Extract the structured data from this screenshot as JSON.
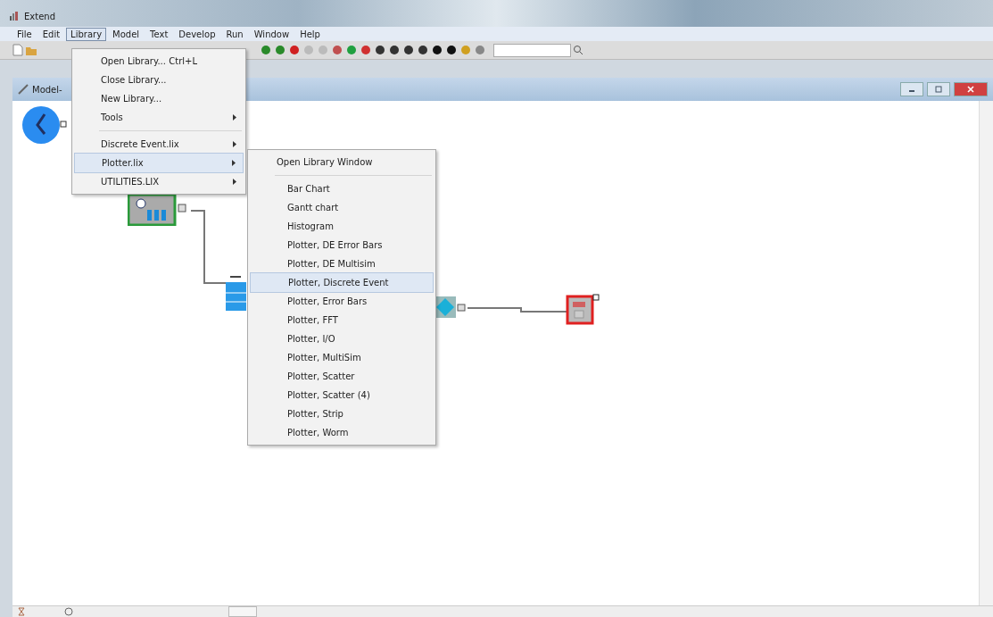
{
  "window": {
    "title": "Extend"
  },
  "menu_bar": [
    {
      "label": "File",
      "selected": false
    },
    {
      "label": "Edit",
      "selected": false
    },
    {
      "label": "Library",
      "selected": true
    },
    {
      "label": "Model",
      "selected": false
    },
    {
      "label": "Text",
      "selected": false
    },
    {
      "label": "Develop",
      "selected": false
    },
    {
      "label": "Run",
      "selected": false
    },
    {
      "label": "Window",
      "selected": false
    },
    {
      "label": "Help",
      "selected": false
    }
  ],
  "library_menu": [
    {
      "kind": "item",
      "label": "Open Library...",
      "shortcut": "Ctrl+L",
      "submenu": false,
      "selected": false
    },
    {
      "kind": "item",
      "label": "Close Library...",
      "submenu": false,
      "selected": false
    },
    {
      "kind": "item",
      "label": "New Library...",
      "submenu": false,
      "selected": false
    },
    {
      "kind": "item",
      "label": "Tools",
      "submenu": true,
      "selected": false
    },
    {
      "kind": "separator"
    },
    {
      "kind": "item",
      "label": "Discrete Event.lix",
      "submenu": true,
      "selected": false
    },
    {
      "kind": "item",
      "label": "Plotter.lix",
      "submenu": true,
      "selected": true
    },
    {
      "kind": "item",
      "label": "UTILITIES.LIX",
      "submenu": true,
      "selected": false
    }
  ],
  "plotter_submenu": [
    {
      "kind": "item",
      "label": "Open Library Window",
      "selected": false
    },
    {
      "kind": "separator"
    },
    {
      "kind": "item",
      "label": "Bar Chart",
      "selected": false
    },
    {
      "kind": "item",
      "label": "Gantt chart",
      "selected": false
    },
    {
      "kind": "item",
      "label": "Histogram",
      "selected": false
    },
    {
      "kind": "item",
      "label": "Plotter, DE Error Bars",
      "selected": false
    },
    {
      "kind": "item",
      "label": "Plotter, DE Multisim",
      "selected": false
    },
    {
      "kind": "item",
      "label": "Plotter, Discrete Event",
      "selected": true
    },
    {
      "kind": "item",
      "label": "Plotter, Error Bars",
      "selected": false
    },
    {
      "kind": "item",
      "label": "Plotter, FFT",
      "selected": false
    },
    {
      "kind": "item",
      "label": "Plotter, I/O",
      "selected": false
    },
    {
      "kind": "item",
      "label": "Plotter, MultiSim",
      "selected": false
    },
    {
      "kind": "item",
      "label": "Plotter, Scatter",
      "selected": false
    },
    {
      "kind": "item",
      "label": "Plotter, Scatter (4)",
      "selected": false
    },
    {
      "kind": "item",
      "label": "Plotter, Strip",
      "selected": false
    },
    {
      "kind": "item",
      "label": "Plotter, Worm",
      "selected": false
    }
  ],
  "model_window": {
    "title": "Model-"
  }
}
